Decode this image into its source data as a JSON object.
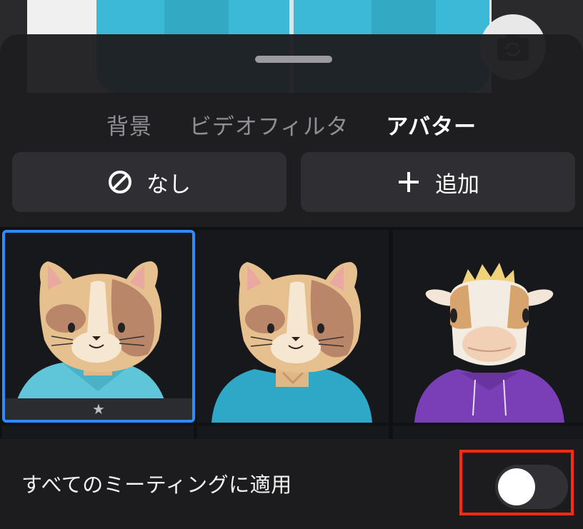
{
  "tabs": [
    {
      "label": "背景",
      "active": false
    },
    {
      "label": "ビデオフィルタ",
      "active": false
    },
    {
      "label": "アバター",
      "active": true
    }
  ],
  "buttons": {
    "none_label": "なし",
    "add_label": "追加"
  },
  "avatars": [
    {
      "name": "cat-light-blue-hoodie",
      "selected": true,
      "favorite": true
    },
    {
      "name": "cat-teal-shirt",
      "selected": false,
      "favorite": false
    },
    {
      "name": "cow-purple-hoodie",
      "selected": false,
      "favorite": false
    }
  ],
  "footer": {
    "apply_all_label": "すべてのミーティングに適用",
    "apply_all_enabled": false
  },
  "colors": {
    "accent": "#2d8cff",
    "highlight": "#ff2a12",
    "background": "#1c1c1f"
  }
}
